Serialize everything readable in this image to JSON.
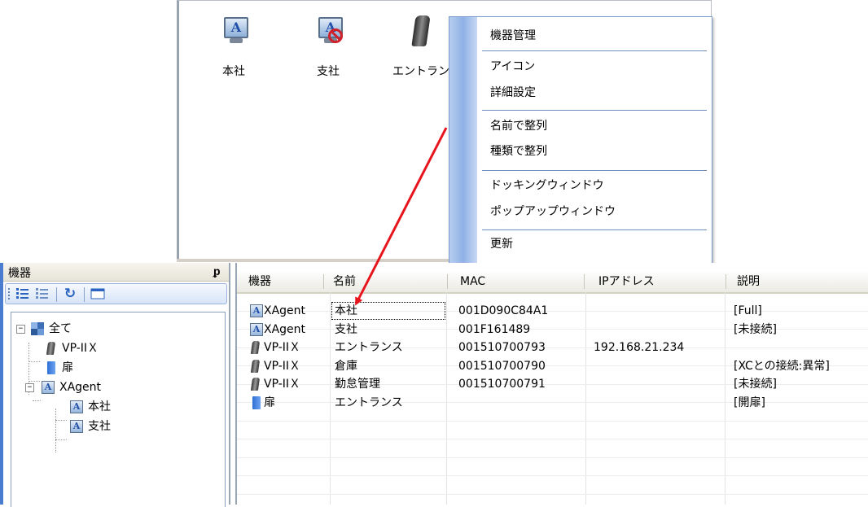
{
  "icon_view": {
    "icons": [
      {
        "label": "本社",
        "icon": "monitor-icon"
      },
      {
        "label": "支社",
        "icon": "monitor-disconnected-icon"
      },
      {
        "label": "エントランス",
        "icon": "camera-icon"
      }
    ]
  },
  "context_menu": {
    "items": [
      "機器管理",
      "アイコン",
      "詳細設定",
      "名前で整列",
      "種類で整列",
      "ドッキングウィンドウ",
      "ポップアップウィンドウ",
      "更新"
    ]
  },
  "dock_pane": {
    "title": "機器",
    "pin_glyph": "ᵱ",
    "toolbar": {
      "refresh_glyph": "↻"
    },
    "tree": [
      {
        "label": "全て",
        "icon": "all-devices-icon",
        "expander": "−"
      },
      {
        "label": "VP-IIＸ",
        "icon": "camera-icon"
      },
      {
        "label": "扉",
        "icon": "door-icon"
      },
      {
        "label": "XAgent",
        "icon": "monitor-icon",
        "expander": "−"
      },
      {
        "label": "本社",
        "icon": "monitor-icon"
      },
      {
        "label": "支社",
        "icon": "monitor-icon"
      }
    ]
  },
  "grid": {
    "columns": [
      "機器",
      "名前",
      "MAC",
      "IPアドレス",
      "説明"
    ],
    "rows": [
      {
        "device": "XAgent",
        "icon": "monitor-icon",
        "name": "本社",
        "mac": "001D090C84A1",
        "ip": "",
        "desc": "[Full]"
      },
      {
        "device": "XAgent",
        "icon": "monitor-icon",
        "name": "支社",
        "mac": "001F161489",
        "ip": "",
        "desc": "[未接続]"
      },
      {
        "device": "VP-IIＸ",
        "icon": "camera-icon",
        "name": "エントランス",
        "mac": "001510700793",
        "ip": "192.168.21.234",
        "desc": ""
      },
      {
        "device": "VP-IIＸ",
        "icon": "camera-icon",
        "name": "倉庫",
        "mac": "001510700790",
        "ip": "",
        "desc": "[XCとの接続:異常]"
      },
      {
        "device": "VP-IIＸ",
        "icon": "camera-icon",
        "name": "勤怠管理",
        "mac": "001510700791",
        "ip": "",
        "desc": "[未接続]"
      },
      {
        "device": "扉",
        "icon": "door-icon",
        "name": "エントランス",
        "mac": "",
        "ip": "",
        "desc": "[開扉]"
      }
    ]
  },
  "colors": {
    "arrow": "#e8141c",
    "menu_border": "#7d9bc9",
    "dock_accent": "#4a7dd0"
  }
}
